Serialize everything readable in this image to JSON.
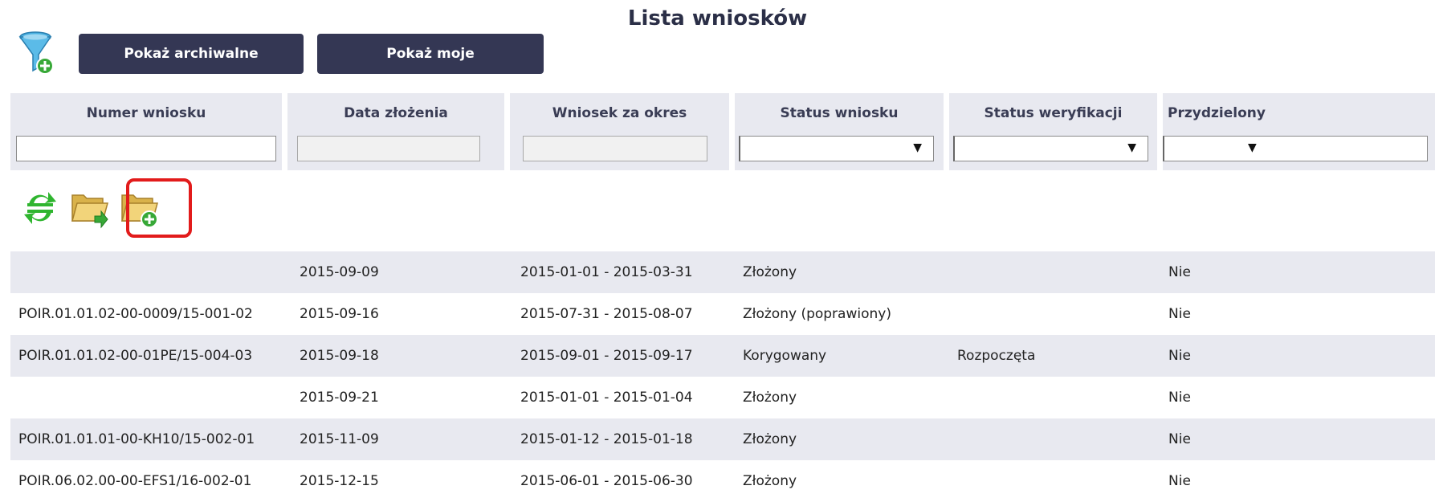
{
  "title": "Lista wniosków",
  "toolbar": {
    "filter_icon": "funnel-add-icon",
    "show_archived": "Pokaż archiwalne",
    "show_mine": "Pokaż moje"
  },
  "columns": [
    {
      "label": "Numer wniosku",
      "filter": "input",
      "value": ""
    },
    {
      "label": "Data złożenia",
      "filter": "input",
      "value": ""
    },
    {
      "label": "Wniosek za okres",
      "filter": "input",
      "value": ""
    },
    {
      "label": "Status wniosku",
      "filter": "select",
      "value": ""
    },
    {
      "label": "Status weryfikacji",
      "filter": "select",
      "value": ""
    },
    {
      "label": "Przydzielony",
      "filter": "select",
      "value": ""
    }
  ],
  "actions": {
    "refresh_icon": "refresh-icon",
    "open_icon": "folder-open-icon",
    "new_icon": "folder-add-icon"
  },
  "rows": [
    {
      "numer": "",
      "data": "2015-09-09",
      "okres": "2015-01-01 - 2015-03-31",
      "status": "Złożony",
      "weryfikacja": "",
      "przydzielony": "Nie"
    },
    {
      "numer": "POIR.01.01.02-00-0009/15-001-02",
      "data": "2015-09-16",
      "okres": "2015-07-31 - 2015-08-07",
      "status": "Złożony (poprawiony)",
      "weryfikacja": "",
      "przydzielony": "Nie"
    },
    {
      "numer": "POIR.01.01.02-00-01PE/15-004-03",
      "data": "2015-09-18",
      "okres": "2015-09-01 - 2015-09-17",
      "status": "Korygowany",
      "weryfikacja": "Rozpoczęta",
      "przydzielony": "Nie"
    },
    {
      "numer": "",
      "data": "2015-09-21",
      "okres": "2015-01-01 - 2015-01-04",
      "status": "Złożony",
      "weryfikacja": "",
      "przydzielony": "Nie"
    },
    {
      "numer": "POIR.01.01.01-00-KH10/15-002-01",
      "data": "2015-11-09",
      "okres": "2015-01-12 - 2015-01-18",
      "status": "Złożony",
      "weryfikacja": "",
      "przydzielony": "Nie"
    },
    {
      "numer": "POIR.06.02.00-00-EFS1/16-002-01",
      "data": "2015-12-15",
      "okres": "2015-06-01 - 2015-06-30",
      "status": "Złożony",
      "weryfikacja": "",
      "przydzielony": "Nie"
    }
  ],
  "colors": {
    "button_bg": "#343754",
    "header_bg": "#e8e9f0",
    "highlight": "#e21b1b"
  }
}
